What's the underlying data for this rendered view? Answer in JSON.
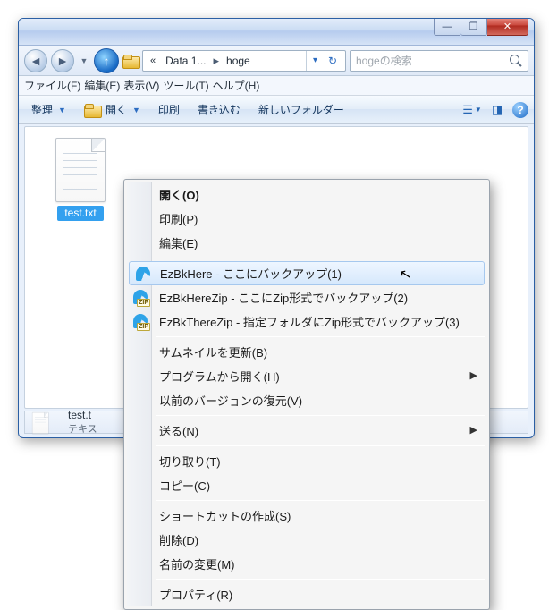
{
  "titlebar": {
    "min": "—",
    "max": "❐",
    "close": "✕"
  },
  "nav": {
    "breadcrumb_prefix": "«",
    "crumb1": "Data 1...",
    "sep": "▸",
    "crumb2": "hoge",
    "refresh": "↻",
    "search_placeholder": "hogeの検索"
  },
  "menubar": [
    "ファイル(F)",
    "編集(E)",
    "表示(V)",
    "ツール(T)",
    "ヘルプ(H)"
  ],
  "toolbar": {
    "organize": "整理",
    "open": "開く",
    "print": "印刷",
    "burn": "書き込む",
    "newfolder": "新しいフォルダー",
    "help": "?"
  },
  "file": {
    "name": "test.txt"
  },
  "status": {
    "name": "test.t",
    "sub": "テキス"
  },
  "ctx": {
    "open": "開く(O)",
    "print": "印刷(P)",
    "edit": "編集(E)",
    "ez1": "EzBkHere - ここにバックアップ(1)",
    "ez2": "EzBkHereZip - ここにZip形式でバックアップ(2)",
    "ez3": "EzBkThereZip - 指定フォルダにZip形式でバックアップ(3)",
    "thumb": "サムネイルを更新(B)",
    "openwith": "プログラムから開く(H)",
    "prev": "以前のバージョンの復元(V)",
    "sendto": "送る(N)",
    "cut": "切り取り(T)",
    "copy": "コピー(C)",
    "shortcut": "ショートカットの作成(S)",
    "delete": "削除(D)",
    "rename": "名前の変更(M)",
    "props": "プロパティ(R)",
    "zip": "ZIP"
  }
}
